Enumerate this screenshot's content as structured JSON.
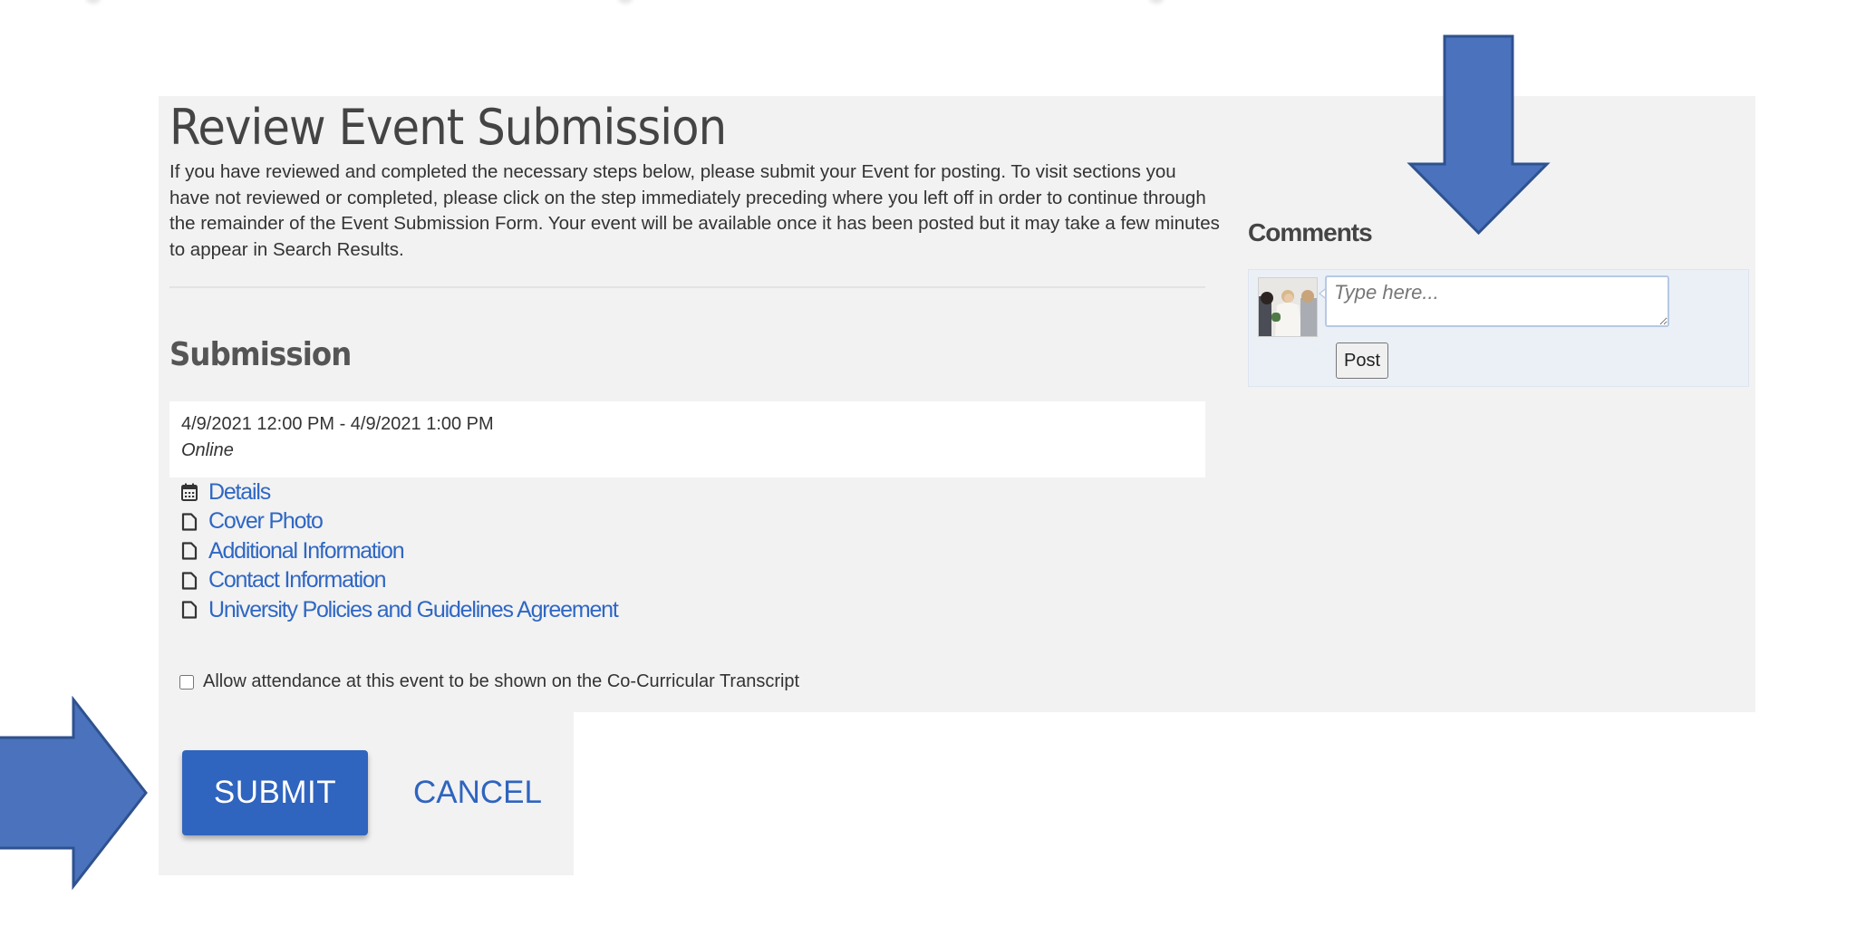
{
  "page": {
    "title": "Review Event Submission",
    "intro": "If you have reviewed and completed the necessary steps below, please submit your Event for posting. To visit sections you have not reviewed or completed, please click on the step immediately preceding where you left off in order to continue through the remainder of the Event Submission Form. Your event will be available once it has been posted but it may take a few minutes to appear in Search Results."
  },
  "submission": {
    "heading": "Submission",
    "event": {
      "date_range": "4/9/2021 12:00 PM - 4/9/2021 1:00 PM",
      "location": "Online"
    },
    "steps": [
      {
        "label": "Details",
        "icon": "calendar-icon"
      },
      {
        "label": "Cover Photo",
        "icon": "file-icon"
      },
      {
        "label": "Additional Information",
        "icon": "file-icon"
      },
      {
        "label": "Contact Information",
        "icon": "file-icon"
      },
      {
        "label": "University Policies and Guidelines Agreement",
        "icon": "file-icon"
      }
    ],
    "ccr_checkbox": {
      "label": "Allow attendance at this event to be shown on the Co-Curricular Transcript",
      "checked": false
    }
  },
  "actions": {
    "submit_label": "SUBMIT",
    "cancel_label": "CANCEL"
  },
  "comments": {
    "heading": "Comments",
    "input_placeholder": "Type here...",
    "post_label": "Post"
  },
  "annotations": {
    "arrow_color": "#4a72bd",
    "arrow_border": "#2f528f",
    "arrows": [
      "pointing-right-at-submit",
      "pointing-down-at-comments"
    ]
  },
  "colors": {
    "link": "#2f67c4",
    "primary_button": "#2f64bf",
    "panel_background": "#f2f2f2"
  }
}
